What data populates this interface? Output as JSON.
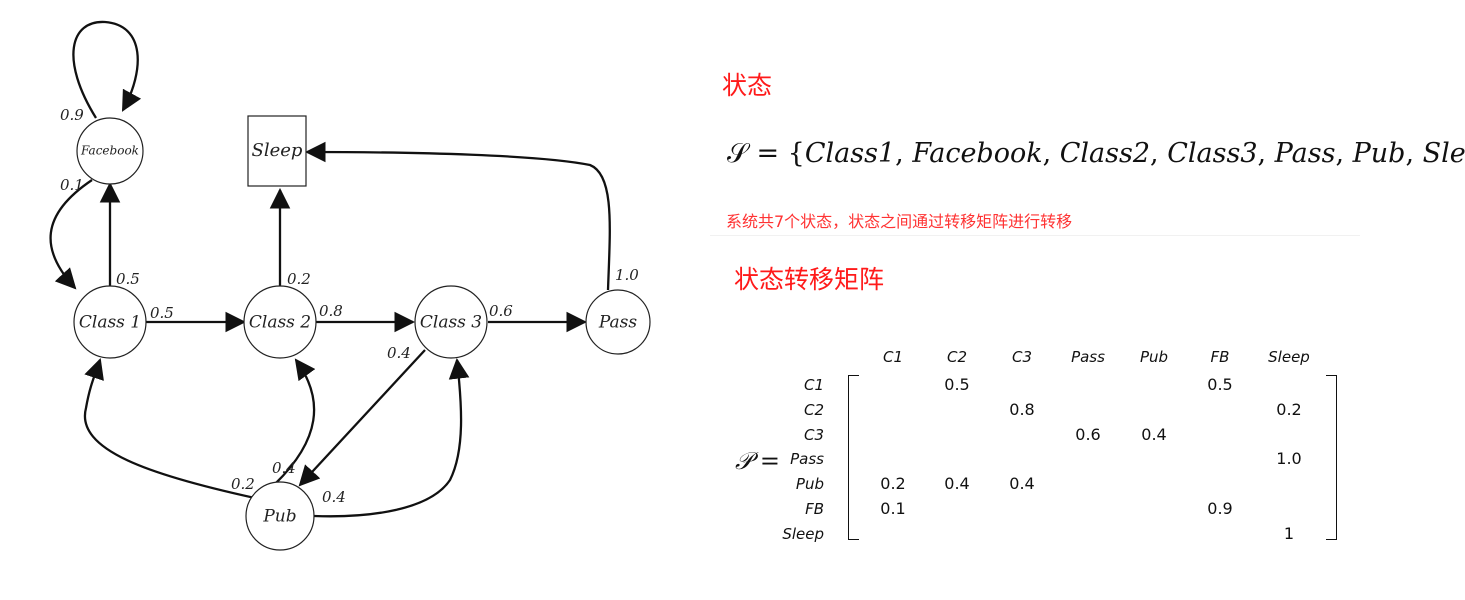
{
  "diagram": {
    "nodes": {
      "facebook": "Facebook",
      "sleep": "Sleep",
      "class1": "Class 1",
      "class2": "Class 2",
      "class3": "Class 3",
      "pass": "Pass",
      "pub": "Pub"
    },
    "edges": {
      "fb_to_fb": "0.9",
      "fb_to_c1": "0.1",
      "c1_to_fb": "0.5",
      "c1_to_c2": "0.5",
      "c2_to_sleep": "0.2",
      "c2_to_c3": "0.8",
      "c3_to_pass": "0.6",
      "c3_to_pub": "0.4",
      "pass_to_sleep": "1.0",
      "pub_to_c1": "0.2",
      "pub_to_c2": "0.4",
      "pub_to_c3": "0.4"
    }
  },
  "states_section": {
    "heading": "状态",
    "set_prefix": "𝒮 = {",
    "set_items": [
      "Class1",
      "Facebook",
      "Class2",
      "Class3",
      "Pass",
      "Pub",
      "Sleep"
    ],
    "set_suffix": "}",
    "note": "系统共7个状态，状态之间通过转移矩阵进行转移"
  },
  "matrix_section": {
    "heading": "状态转移矩阵",
    "symbol": "𝒫 =",
    "columns": [
      "C1",
      "C2",
      "C3",
      "Pass",
      "Pub",
      "FB",
      "Sleep"
    ],
    "rows": [
      "C1",
      "C2",
      "C3",
      "Pass",
      "Pub",
      "FB",
      "Sleep"
    ],
    "cells": [
      [
        "",
        "0.5",
        "",
        "",
        "",
        "0.5",
        ""
      ],
      [
        "",
        "",
        "0.8",
        "",
        "",
        "",
        "0.2"
      ],
      [
        "",
        "",
        "",
        "0.6",
        "0.4",
        "",
        ""
      ],
      [
        "",
        "",
        "",
        "",
        "",
        "",
        "1.0"
      ],
      [
        "0.2",
        "0.4",
        "0.4",
        "",
        "",
        "",
        ""
      ],
      [
        "0.1",
        "",
        "",
        "",
        "",
        "0.9",
        ""
      ],
      [
        "",
        "",
        "",
        "",
        "",
        "",
        "1"
      ]
    ]
  }
}
